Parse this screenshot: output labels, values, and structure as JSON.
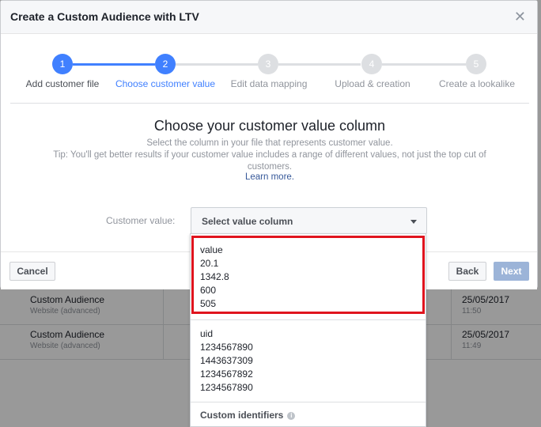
{
  "modal": {
    "title": "Create a Custom Audience with LTV",
    "close_icon": "close-icon",
    "steps": [
      {
        "number": "1",
        "label": "Add customer file",
        "state": "done"
      },
      {
        "number": "2",
        "label": "Choose customer value",
        "state": "current"
      },
      {
        "number": "3",
        "label": "Edit data mapping",
        "state": "todo"
      },
      {
        "number": "4",
        "label": "Upload & creation",
        "state": "todo"
      },
      {
        "number": "5",
        "label": "Create a lookalike",
        "state": "todo"
      }
    ],
    "heading": "Choose your customer value column",
    "description_line1": "Select the column in your file that represents customer value.",
    "description_line2": "Tip: You'll get better results if your customer value includes a range of different values, not just the top cut of customers.",
    "learn_more": "Learn more",
    "learn_more_suffix": ".",
    "customer_value_label": "Customer value:",
    "select_placeholder": "Select value column",
    "footer": {
      "cancel": "Cancel",
      "back": "Back",
      "next": "Next"
    }
  },
  "dropdown": {
    "group1": [
      "value",
      "20.1",
      "1342.8",
      "600",
      "505"
    ],
    "group2": [
      "uid",
      "1234567890",
      "1443637309",
      "1234567892",
      "1234567890"
    ],
    "custom_identifiers": "Custom identifiers",
    "info_icon": "info-icon"
  },
  "background_table": {
    "rows": [
      {
        "name": "Custom Audience",
        "sub": "Website (advanced)",
        "date": "25/05/2017",
        "time": "11:50"
      },
      {
        "name": "Custom Audience",
        "sub": "Website (advanced)",
        "date": "25/05/2017",
        "time": "11:49"
      }
    ]
  },
  "colors": {
    "accent": "#4080ff",
    "highlight": "#e0141e"
  }
}
